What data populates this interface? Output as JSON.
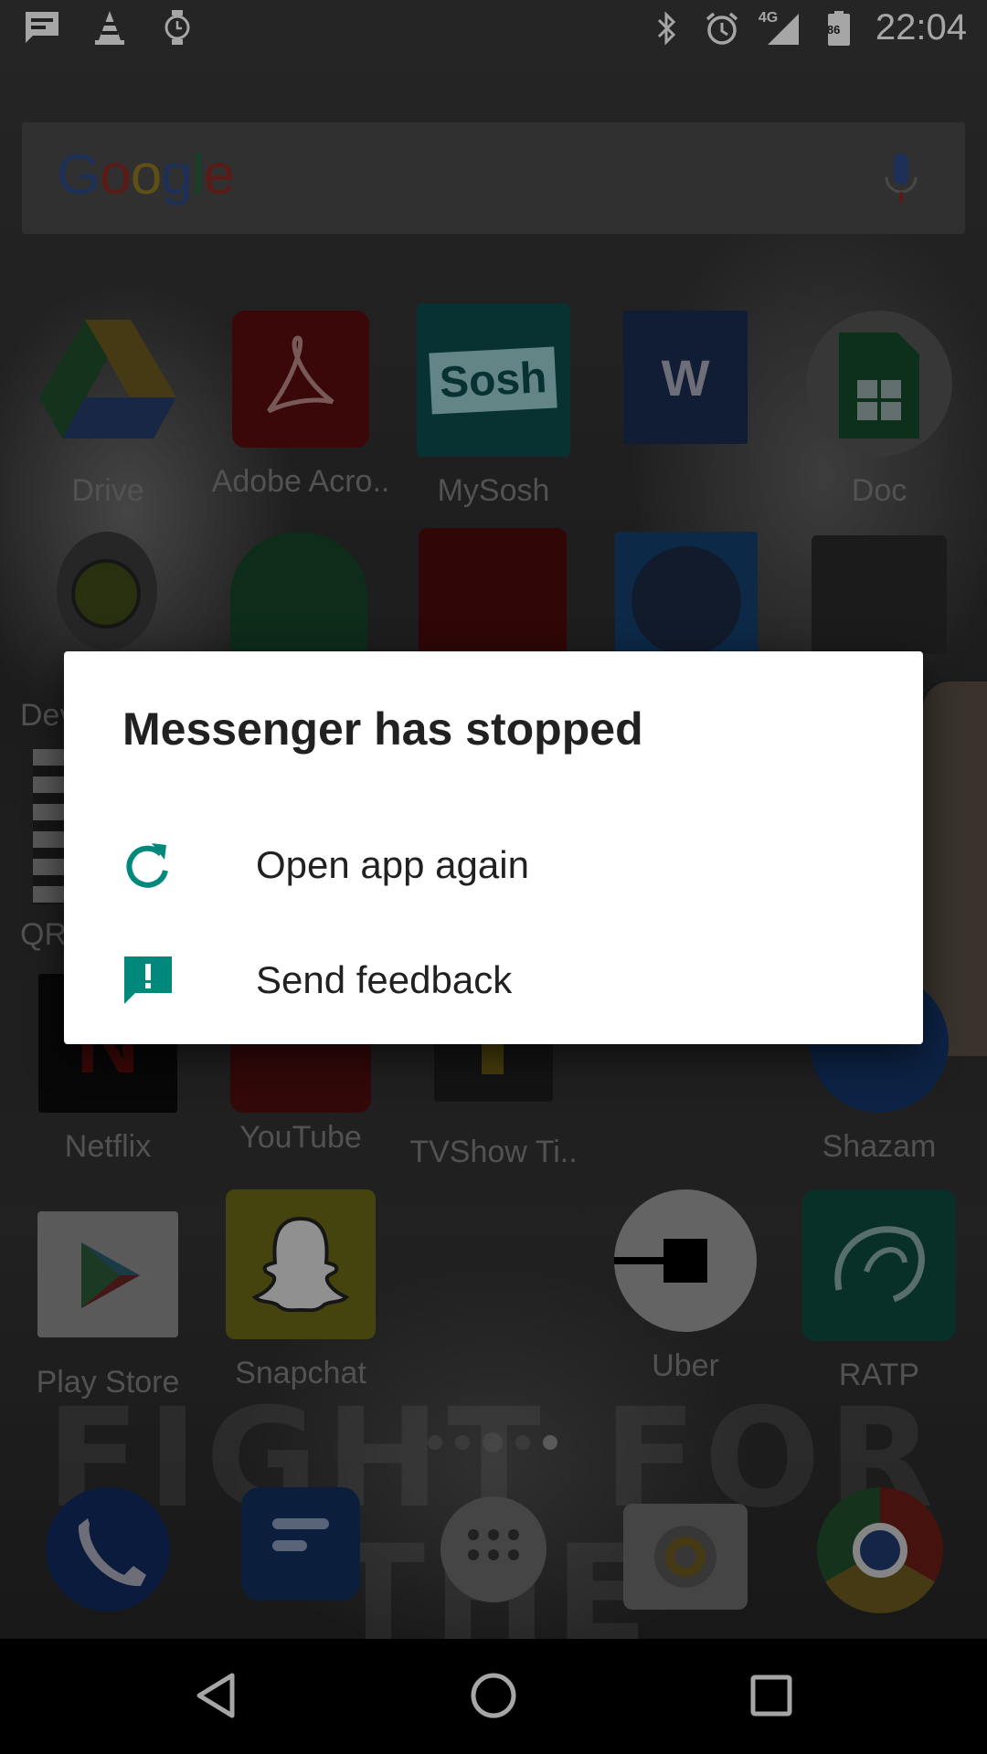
{
  "status_bar": {
    "time": "22:04",
    "network": "4G",
    "battery_level": "86",
    "left_icons": [
      "message-notification-icon",
      "vlc-cone-icon",
      "watch-icon"
    ],
    "right_icons": [
      "bluetooth-icon",
      "alarm-icon",
      "signal-icon",
      "battery-icon"
    ]
  },
  "search_bar": {
    "logo_letters": [
      "G",
      "o",
      "o",
      "g",
      "l",
      "e"
    ]
  },
  "apps": {
    "row1": [
      {
        "label": "Drive"
      },
      {
        "label": "Adobe Acro.."
      },
      {
        "label": "MySosh",
        "icon_text": "Sosh"
      },
      {
        "label": ""
      },
      {
        "label": "Doc"
      }
    ],
    "row2_partial": [
      {
        "label": "Dev"
      },
      {
        "label": "QR"
      }
    ],
    "row3": [
      {
        "label": "Netflix",
        "icon_text": "N"
      },
      {
        "label": "YouTube"
      },
      {
        "label": "TVShow Ti.."
      },
      {
        "label": "Shazam"
      }
    ],
    "row4": [
      {
        "label": "Play Store"
      },
      {
        "label": "Snapchat"
      },
      {
        "label": "Uber"
      },
      {
        "label": "RATP"
      }
    ]
  },
  "wallpaper_text": {
    "line1": "FIGHT FOR",
    "line2": "THE FUTURE"
  },
  "dock": [
    "phone-icon",
    "messages-icon",
    "app-drawer-icon",
    "camera-icon",
    "chrome-icon"
  ],
  "dialog": {
    "title": "Messenger has stopped",
    "options": [
      {
        "label": "Open app again",
        "icon": "refresh-icon"
      },
      {
        "label": "Send feedback",
        "icon": "feedback-icon"
      }
    ],
    "accent_color": "#00897B"
  },
  "nav": [
    "back-icon",
    "home-icon",
    "recents-icon"
  ]
}
